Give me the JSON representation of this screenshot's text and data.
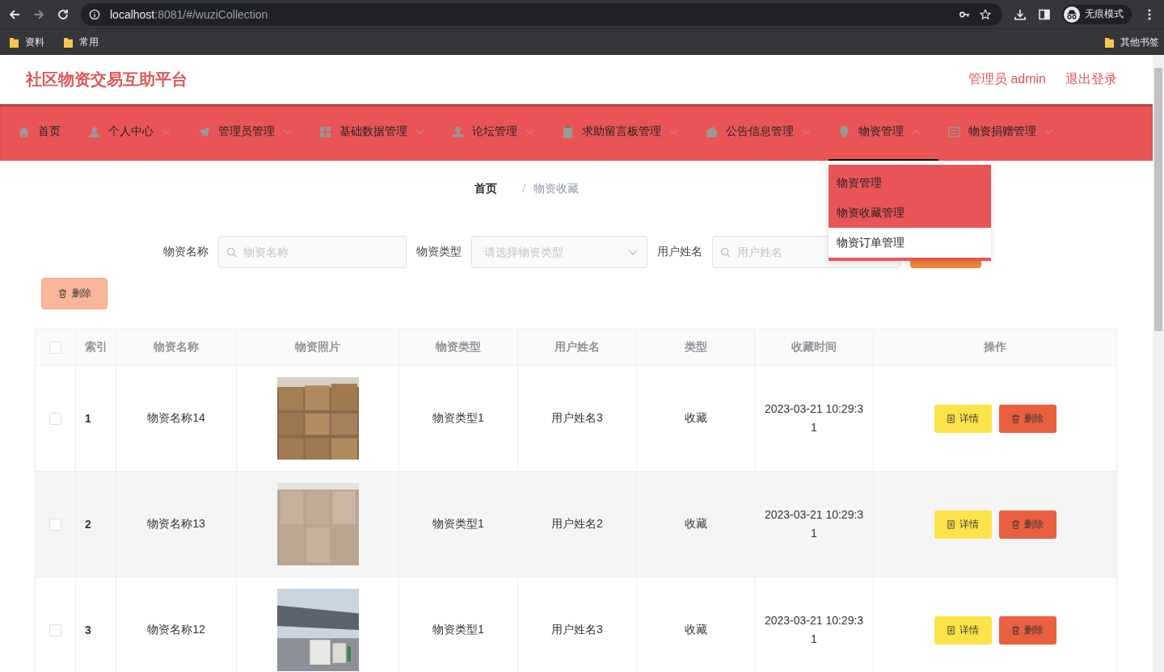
{
  "browser": {
    "url_host": "localhost",
    "url_rest": ":8081/#/wuziCollection",
    "profile": "无痕模式",
    "bookmarks": [
      {
        "label": "资料"
      },
      {
        "label": "常用"
      }
    ],
    "other_bookmarks": "其他书签"
  },
  "header": {
    "title": "社区物资交易互助平台",
    "user": "管理员 admin",
    "logout": "退出登录"
  },
  "nav": [
    {
      "label": "首页",
      "has_menu": false,
      "selected": false
    },
    {
      "label": "个人中心",
      "has_menu": true,
      "selected": false
    },
    {
      "label": "管理员管理",
      "has_menu": true,
      "selected": false
    },
    {
      "label": "基础数据管理",
      "has_menu": true,
      "selected": false
    },
    {
      "label": "论坛管理",
      "has_menu": true,
      "selected": false
    },
    {
      "label": "求助留言板管理",
      "has_menu": true,
      "selected": false
    },
    {
      "label": "公告信息管理",
      "has_menu": true,
      "selected": false
    },
    {
      "label": "物资管理",
      "has_menu": true,
      "selected": true,
      "open": true
    },
    {
      "label": "物资捐赠管理",
      "has_menu": true,
      "selected": false
    }
  ],
  "dropdown": [
    {
      "label": "物资管理",
      "highlighted": true
    },
    {
      "label": "物资收藏管理",
      "highlighted": true
    },
    {
      "label": "物资订单管理",
      "highlighted": false
    }
  ],
  "breadcrumb": {
    "items": [
      "首页",
      "物资收藏"
    ],
    "separator": "/"
  },
  "filters": [
    {
      "label": "物资名称",
      "kind": "search",
      "placeholder": "物资名称"
    },
    {
      "label": "物资类型",
      "kind": "select",
      "placeholder": "请选择物资类型"
    },
    {
      "label": "用户姓名",
      "kind": "search",
      "placeholder": "用户姓名"
    }
  ],
  "delete_button": "删除",
  "table": {
    "select_all_checked": false,
    "columns": [
      "索引",
      "物资名称",
      "物资照片",
      "物资类型",
      "用户姓名",
      "类型",
      "收藏时间",
      "操作"
    ],
    "rows": [
      {
        "checked": false,
        "index": "1",
        "name": "物资名称14",
        "photo": {
          "kind": "picture"
        },
        "type": "物资类型1",
        "user": "用户姓名3",
        "kind_label": "收藏",
        "time": "2023-03-21 10:29:31",
        "actions": [
          {
            "kind": "detail",
            "label": "详情"
          },
          {
            "kind": "delete",
            "label": "删除"
          }
        ]
      },
      {
        "checked": false,
        "index": "2",
        "name": "物资名称13",
        "photo": {
          "kind": "picture"
        },
        "type": "物资类型1",
        "user": "用户姓名2",
        "kind_label": "收藏",
        "time": "2023-03-21 10:29:31",
        "actions": [
          {
            "kind": "detail",
            "label": "详情"
          },
          {
            "kind": "delete",
            "label": "删除"
          }
        ]
      },
      {
        "checked": false,
        "index": "3",
        "name": "物资名称12",
        "photo": {
          "kind": "picture"
        },
        "type": "物资类型1",
        "user": "用户姓名3",
        "kind_label": "收藏",
        "time": "2023-03-21 10:29:31",
        "actions": [
          {
            "kind": "detail",
            "label": "详情"
          },
          {
            "kind": "delete",
            "label": "删除"
          }
        ]
      }
    ]
  }
}
